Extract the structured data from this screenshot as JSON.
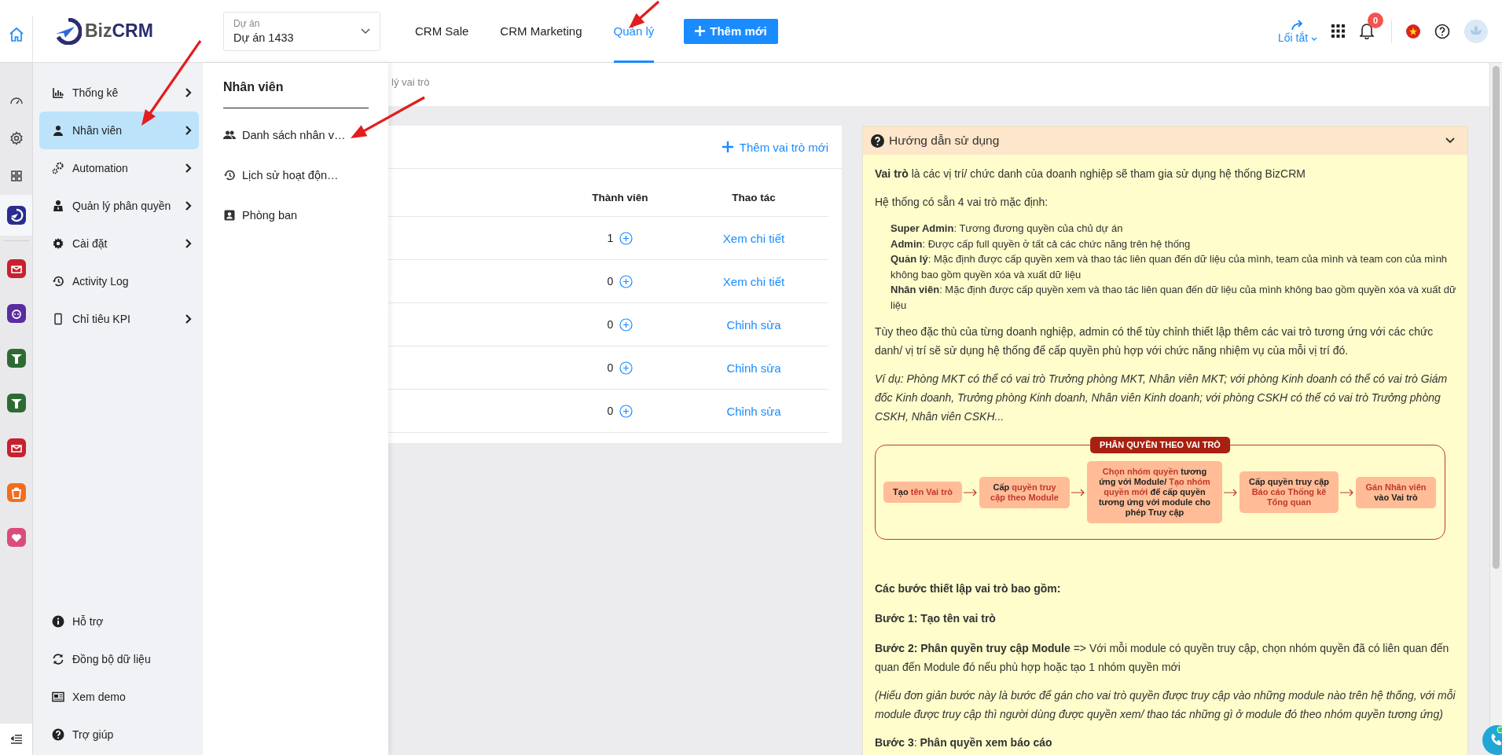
{
  "header": {
    "logo": {
      "prefix": "Biz",
      "suffix": "CRM"
    },
    "project_select": {
      "label": "Dự án",
      "value": "Dự án 1433"
    },
    "nav": [
      {
        "label": "CRM Sale",
        "selected": false
      },
      {
        "label": "CRM Marketing",
        "selected": false
      },
      {
        "label": "Quản lý",
        "selected": true
      }
    ],
    "add_button": "Thêm mới",
    "shortcuts": "Lối tắt",
    "notification_count": "0"
  },
  "menu": {
    "items": [
      {
        "label": "Thống kê",
        "has_submenu": true,
        "selected": false
      },
      {
        "label": "Nhân viên",
        "has_submenu": true,
        "selected": true
      },
      {
        "label": "Automation",
        "has_submenu": true,
        "selected": false
      },
      {
        "label": "Quản lý phân quyền",
        "has_submenu": true,
        "selected": false
      },
      {
        "label": "Cài đặt",
        "has_submenu": true,
        "selected": false
      },
      {
        "label": "Activity Log",
        "has_submenu": false,
        "selected": false
      },
      {
        "label": "Chỉ tiêu KPI",
        "has_submenu": true,
        "selected": false
      }
    ],
    "bottom_items": [
      "Hỗ trợ",
      "Đồng bộ dữ liệu",
      "Xem demo",
      "Trợ giúp"
    ]
  },
  "submenu": {
    "title": "Nhân viên",
    "items": [
      "Danh sách nhân v…",
      "Lịch sử hoạt độn…",
      "Phòng ban"
    ]
  },
  "breadcrumb": "lý vai trò",
  "roles_table": {
    "add_link": "Thêm vai trò mới",
    "columns": [
      "Thành viên",
      "Thao tác"
    ],
    "rows": [
      {
        "members": "1",
        "action": "Xem chi tiết"
      },
      {
        "members": "0",
        "action": "Xem chi tiết"
      },
      {
        "members": "0",
        "action": "Chỉnh sửa"
      },
      {
        "members": "0",
        "action": "Chỉnh sửa"
      },
      {
        "members": "0",
        "action": "Chỉnh sửa"
      }
    ]
  },
  "guide": {
    "title": "Hướng dẫn sử dụng",
    "expanded": true,
    "blocks": [
      {
        "kind": "text",
        "text": "**Vai trò** là các vị trí/ chức danh của doanh nghiệp sẽ tham gia sử dụng hệ thống BizCRM"
      },
      {
        "kind": "text",
        "text": "Hệ thống có sẵn 4 vai trò mặc định:"
      },
      {
        "kind": "list",
        "items": [
          "**Super Admin**: Tương đương quyền của chủ dự án",
          "**Admin**: Được cấp full quyền ở tất cả các chức năng trên hệ thống",
          "**Quản lý**: Mặc định được cấp quyền xem và thao tác liên quan đến dữ liệu của mình, team của mình và team con của mình không bao gồm quyền xóa và xuất dữ liệu",
          "**Nhân viên**: Mặc định được cấp quyền xem và thao tác liên quan đến dữ liệu của mình không bao gồm quyền xóa và xuất dữ liệu"
        ]
      },
      {
        "kind": "text",
        "text": "Tùy theo đặc thù của từng doanh nghiệp, admin có thể tùy chỉnh thiết lập thêm các vai trò tương ứng với các chức danh/ vị trí sẽ sử dụng hệ thống để cấp quyền phù hợp với chức năng nhiệm vụ của mỗi vị trí đó."
      },
      {
        "kind": "note",
        "text": "Ví dụ: Phòng MKT có thể có vai trò Trưởng phòng MKT, Nhân viên MKT; với phòng Kinh doanh có thể có vai trò Giám đốc Kinh doanh, Trưởng phòng Kinh doanh, Nhân viên Kinh doanh; với phòng CSKH có thể có vai trò Trưởng phòng CSKH, Nhân viên CSKH..."
      },
      {
        "kind": "diagram",
        "title": "PHÂN QUYỀN THEO VAI TRÒ",
        "steps": [
          [
            {
              "text": "Tạo ",
              "highlight": false
            },
            {
              "text": "tên Vai trò",
              "highlight": true
            }
          ],
          [
            {
              "text": "Cấp ",
              "highlight": false
            },
            {
              "text": "quyền truy cập theo Module",
              "highlight": true
            }
          ],
          [
            {
              "text": "Chọn nhóm quyền",
              "highlight": true
            },
            {
              "text": " tương ứng với Module/ ",
              "highlight": false
            },
            {
              "text": "Tạo nhóm quyền mới",
              "highlight": true
            },
            {
              "text": " để cấp quyền tương ứng với module cho phép Truy cập",
              "highlight": false
            }
          ],
          [
            {
              "text": "Cấp quyền truy cập ",
              "highlight": false
            },
            {
              "text": "Báo cáo Thống kê Tổng quan",
              "highlight": true
            }
          ],
          [
            {
              "text": "Gán Nhân viên",
              "highlight": true
            },
            {
              "text": " vào Vai trò",
              "highlight": false
            }
          ]
        ]
      },
      {
        "kind": "heading",
        "text": "Các bước thiết lập vai trò bao gồm:"
      },
      {
        "kind": "heading",
        "text": "Bước 1: Tạo tên vai trò"
      },
      {
        "kind": "text",
        "text": "**Bước 2: Phân quyền truy cập Module** => Với mỗi module có quyền truy cập, chọn nhóm quyền đã có liên quan đến quan đến Module đó nếu phù hợp hoặc tạo 1 nhóm quyền mới"
      },
      {
        "kind": "note",
        "text": "(Hiểu đơn giản bước này là bước để gán cho vai trò quyền được truy cập vào những module nào trên hệ thống, với mỗi module được truy cập thì người dùng được quyền xem/ thao tác những gì ở module đó theo nhóm quyền tương ứng)"
      },
      {
        "kind": "text",
        "text": "**Bước 3**: **Phân quyền xem báo cáo**"
      }
    ]
  }
}
